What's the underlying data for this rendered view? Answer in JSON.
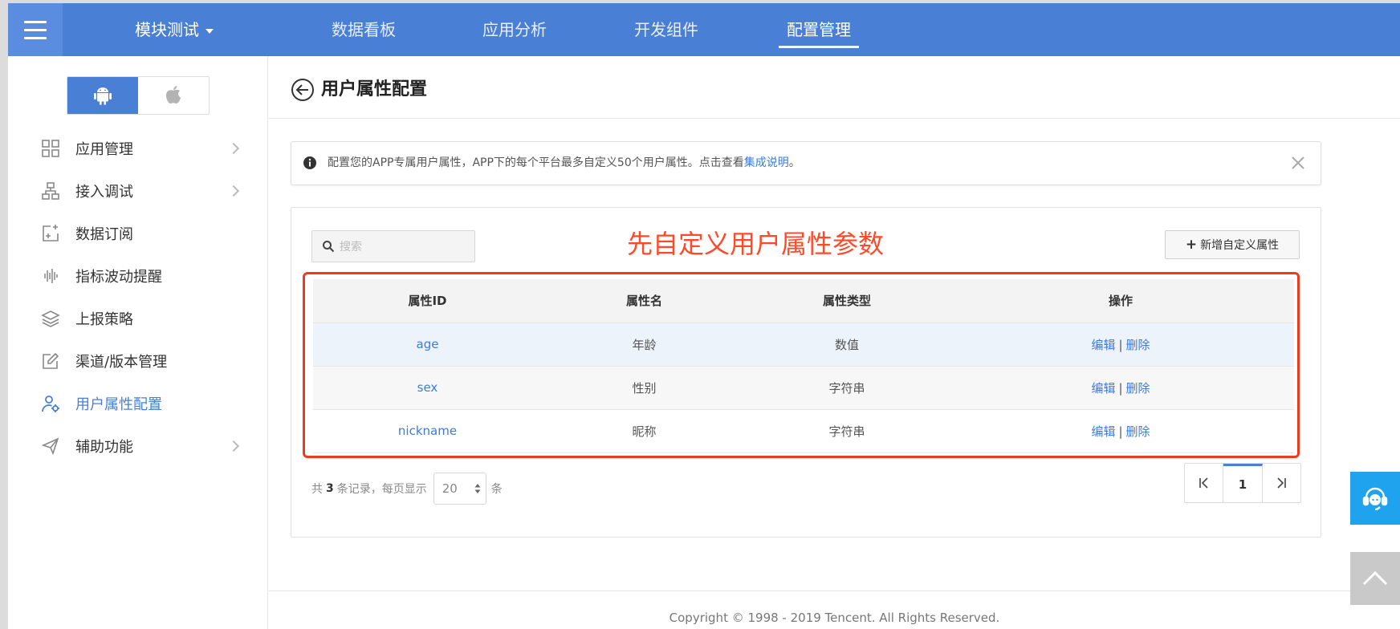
{
  "topnav": {
    "module": "模块测试",
    "items": [
      "数据看板",
      "应用分析",
      "开发组件",
      "配置管理"
    ],
    "active_index": 3
  },
  "sidebar": {
    "platforms": [
      {
        "icon": "android-icon",
        "active": true
      },
      {
        "icon": "apple-icon",
        "active": false
      }
    ],
    "items": [
      {
        "label": "应用管理",
        "icon": "grid-icon",
        "has_arrow": true
      },
      {
        "label": "接入调试",
        "icon": "sitemap-icon",
        "has_arrow": true
      },
      {
        "label": "数据订阅",
        "icon": "subscribe-icon",
        "has_arrow": false
      },
      {
        "label": "指标波动提醒",
        "icon": "waveform-icon",
        "has_arrow": false
      },
      {
        "label": "上报策略",
        "icon": "layers-icon",
        "has_arrow": false
      },
      {
        "label": "渠道/版本管理",
        "icon": "edit-icon",
        "has_arrow": false
      },
      {
        "label": "用户属性配置",
        "icon": "user-settings-icon",
        "has_arrow": false,
        "active": true
      },
      {
        "label": "辅助功能",
        "icon": "paper-plane-icon",
        "has_arrow": true
      }
    ]
  },
  "page": {
    "title": "用户属性配置"
  },
  "notice": {
    "text": "配置您的APP专属用户属性，APP下的每个平台最多自定义50个用户属性。点击查看",
    "link": "集成说明",
    "suffix": "。"
  },
  "toolbar": {
    "search_placeholder": "搜索",
    "annotation": "先自定义用户属性参数",
    "add_label": "新增自定义属性"
  },
  "table": {
    "columns": [
      "属性ID",
      "属性名",
      "属性类型",
      "操作"
    ],
    "rows": [
      {
        "id": "age",
        "name": "年龄",
        "type": "数值"
      },
      {
        "id": "sex",
        "name": "性别",
        "type": "字符串"
      },
      {
        "id": "nickname",
        "name": "昵称",
        "type": "字符串"
      }
    ],
    "edit_label": "编辑",
    "delete_label": "删除",
    "separator": "|"
  },
  "pagination": {
    "prefix": "共",
    "total": "3",
    "middle": "条记录，每页显示",
    "page_size": "20",
    "suffix": "条",
    "current_page": "1"
  },
  "footer": {
    "copyright": "Copyright © 1998 - 2019 Tencent. All Rights Reserved."
  },
  "colors": {
    "primary": "#4a7fd6",
    "link": "#3a7be0",
    "annotation": "#ff4a2a",
    "support": "#1fa3ef"
  }
}
